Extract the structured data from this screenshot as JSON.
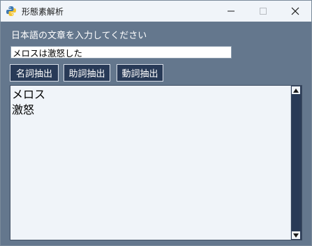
{
  "window": {
    "title": "形態素解析",
    "icon": "python-icon"
  },
  "form": {
    "prompt": "日本語の文章を入力してください",
    "input_value": "メロスは激怒した"
  },
  "buttons": {
    "noun": "名詞抽出",
    "particle": "助詞抽出",
    "verb": "動詞抽出"
  },
  "output": {
    "lines": [
      "メロス",
      "激怒"
    ]
  },
  "colors": {
    "window_bg": "#64778d",
    "button_bg": "#283a57",
    "textarea_bg": "#f0f4f9"
  }
}
